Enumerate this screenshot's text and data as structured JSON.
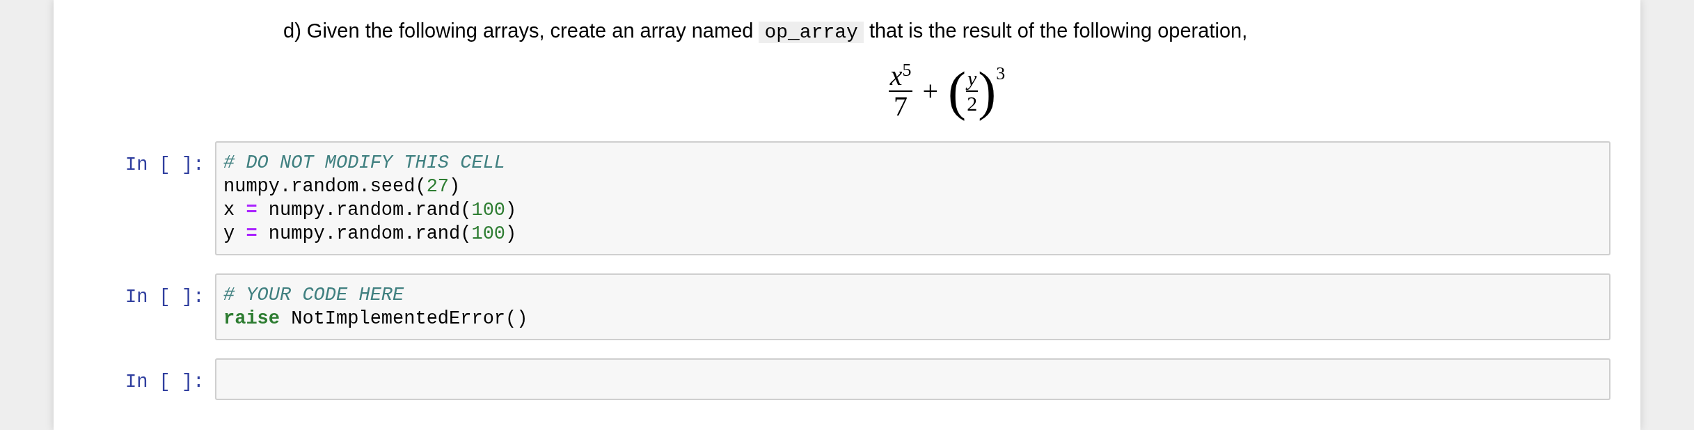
{
  "markdown": {
    "text_before": "d) Given the following arrays, create an array named",
    "code": "op_array",
    "text_after": "that is the result of the following operation,"
  },
  "formula": {
    "numerator_base": "x",
    "numerator_exponent": "5",
    "denominator": "7",
    "operator": "+",
    "left_paren": "(",
    "inner_numerator": "y",
    "inner_denominator": "2",
    "right_paren": ")",
    "outer_exponent": "3"
  },
  "cells": [
    {
      "prompt": "In [ ]:",
      "lines": [
        [
          {
            "kind": "comment",
            "text": "# DO NOT MODIFY THIS CELL"
          }
        ],
        [
          {
            "kind": "name",
            "text": "numpy.random.seed("
          },
          {
            "kind": "number",
            "text": "27"
          },
          {
            "kind": "name",
            "text": ")"
          }
        ],
        [
          {
            "kind": "name",
            "text": "x "
          },
          {
            "kind": "operator",
            "text": "="
          },
          {
            "kind": "name",
            "text": " numpy.random.rand("
          },
          {
            "kind": "number",
            "text": "100"
          },
          {
            "kind": "name",
            "text": ")"
          }
        ],
        [
          {
            "kind": "name",
            "text": "y "
          },
          {
            "kind": "operator",
            "text": "="
          },
          {
            "kind": "name",
            "text": " numpy.random.rand("
          },
          {
            "kind": "number",
            "text": "100"
          },
          {
            "kind": "name",
            "text": ")"
          }
        ]
      ]
    },
    {
      "prompt": "In [ ]:",
      "lines": [
        [
          {
            "kind": "comment",
            "text": "# YOUR CODE HERE"
          }
        ],
        [
          {
            "kind": "keyword",
            "text": "raise"
          },
          {
            "kind": "name",
            "text": " NotImplementedError()"
          }
        ]
      ]
    },
    {
      "prompt": "In [ ]:"
    }
  ]
}
